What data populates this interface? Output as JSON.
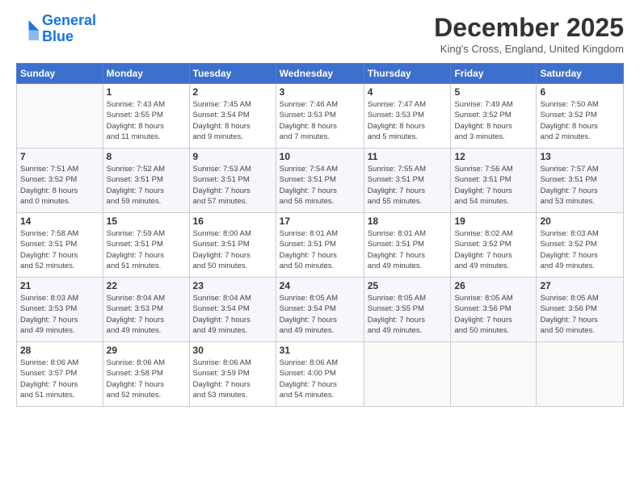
{
  "logo": {
    "line1": "General",
    "line2": "Blue"
  },
  "title": "December 2025",
  "location": "King's Cross, England, United Kingdom",
  "weekdays": [
    "Sunday",
    "Monday",
    "Tuesday",
    "Wednesday",
    "Thursday",
    "Friday",
    "Saturday"
  ],
  "weeks": [
    [
      {
        "day": "",
        "info": ""
      },
      {
        "day": "1",
        "info": "Sunrise: 7:43 AM\nSunset: 3:55 PM\nDaylight: 8 hours\nand 11 minutes."
      },
      {
        "day": "2",
        "info": "Sunrise: 7:45 AM\nSunset: 3:54 PM\nDaylight: 8 hours\nand 9 minutes."
      },
      {
        "day": "3",
        "info": "Sunrise: 7:46 AM\nSunset: 3:53 PM\nDaylight: 8 hours\nand 7 minutes."
      },
      {
        "day": "4",
        "info": "Sunrise: 7:47 AM\nSunset: 3:53 PM\nDaylight: 8 hours\nand 5 minutes."
      },
      {
        "day": "5",
        "info": "Sunrise: 7:49 AM\nSunset: 3:52 PM\nDaylight: 8 hours\nand 3 minutes."
      },
      {
        "day": "6",
        "info": "Sunrise: 7:50 AM\nSunset: 3:52 PM\nDaylight: 8 hours\nand 2 minutes."
      }
    ],
    [
      {
        "day": "7",
        "info": "Sunrise: 7:51 AM\nSunset: 3:52 PM\nDaylight: 8 hours\nand 0 minutes."
      },
      {
        "day": "8",
        "info": "Sunrise: 7:52 AM\nSunset: 3:51 PM\nDaylight: 7 hours\nand 59 minutes."
      },
      {
        "day": "9",
        "info": "Sunrise: 7:53 AM\nSunset: 3:51 PM\nDaylight: 7 hours\nand 57 minutes."
      },
      {
        "day": "10",
        "info": "Sunrise: 7:54 AM\nSunset: 3:51 PM\nDaylight: 7 hours\nand 56 minutes."
      },
      {
        "day": "11",
        "info": "Sunrise: 7:55 AM\nSunset: 3:51 PM\nDaylight: 7 hours\nand 55 minutes."
      },
      {
        "day": "12",
        "info": "Sunrise: 7:56 AM\nSunset: 3:51 PM\nDaylight: 7 hours\nand 54 minutes."
      },
      {
        "day": "13",
        "info": "Sunrise: 7:57 AM\nSunset: 3:51 PM\nDaylight: 7 hours\nand 53 minutes."
      }
    ],
    [
      {
        "day": "14",
        "info": "Sunrise: 7:58 AM\nSunset: 3:51 PM\nDaylight: 7 hours\nand 52 minutes."
      },
      {
        "day": "15",
        "info": "Sunrise: 7:59 AM\nSunset: 3:51 PM\nDaylight: 7 hours\nand 51 minutes."
      },
      {
        "day": "16",
        "info": "Sunrise: 8:00 AM\nSunset: 3:51 PM\nDaylight: 7 hours\nand 50 minutes."
      },
      {
        "day": "17",
        "info": "Sunrise: 8:01 AM\nSunset: 3:51 PM\nDaylight: 7 hours\nand 50 minutes."
      },
      {
        "day": "18",
        "info": "Sunrise: 8:01 AM\nSunset: 3:51 PM\nDaylight: 7 hours\nand 49 minutes."
      },
      {
        "day": "19",
        "info": "Sunrise: 8:02 AM\nSunset: 3:52 PM\nDaylight: 7 hours\nand 49 minutes."
      },
      {
        "day": "20",
        "info": "Sunrise: 8:03 AM\nSunset: 3:52 PM\nDaylight: 7 hours\nand 49 minutes."
      }
    ],
    [
      {
        "day": "21",
        "info": "Sunrise: 8:03 AM\nSunset: 3:53 PM\nDaylight: 7 hours\nand 49 minutes."
      },
      {
        "day": "22",
        "info": "Sunrise: 8:04 AM\nSunset: 3:53 PM\nDaylight: 7 hours\nand 49 minutes."
      },
      {
        "day": "23",
        "info": "Sunrise: 8:04 AM\nSunset: 3:54 PM\nDaylight: 7 hours\nand 49 minutes."
      },
      {
        "day": "24",
        "info": "Sunrise: 8:05 AM\nSunset: 3:54 PM\nDaylight: 7 hours\nand 49 minutes."
      },
      {
        "day": "25",
        "info": "Sunrise: 8:05 AM\nSunset: 3:55 PM\nDaylight: 7 hours\nand 49 minutes."
      },
      {
        "day": "26",
        "info": "Sunrise: 8:05 AM\nSunset: 3:56 PM\nDaylight: 7 hours\nand 50 minutes."
      },
      {
        "day": "27",
        "info": "Sunrise: 8:05 AM\nSunset: 3:56 PM\nDaylight: 7 hours\nand 50 minutes."
      }
    ],
    [
      {
        "day": "28",
        "info": "Sunrise: 8:06 AM\nSunset: 3:57 PM\nDaylight: 7 hours\nand 51 minutes."
      },
      {
        "day": "29",
        "info": "Sunrise: 8:06 AM\nSunset: 3:58 PM\nDaylight: 7 hours\nand 52 minutes."
      },
      {
        "day": "30",
        "info": "Sunrise: 8:06 AM\nSunset: 3:59 PM\nDaylight: 7 hours\nand 53 minutes."
      },
      {
        "day": "31",
        "info": "Sunrise: 8:06 AM\nSunset: 4:00 PM\nDaylight: 7 hours\nand 54 minutes."
      },
      {
        "day": "",
        "info": ""
      },
      {
        "day": "",
        "info": ""
      },
      {
        "day": "",
        "info": ""
      }
    ]
  ]
}
